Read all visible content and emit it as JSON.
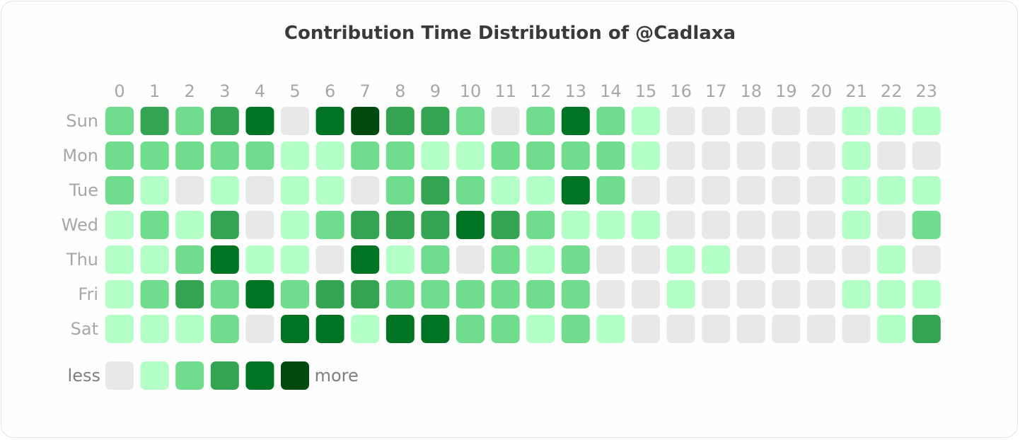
{
  "chart_data": {
    "type": "heatmap",
    "title": "Contribution Time Distribution of @Cadlaxa",
    "xlabel": "",
    "ylabel": "",
    "x": [
      "0",
      "1",
      "2",
      "3",
      "4",
      "5",
      "6",
      "7",
      "8",
      "9",
      "10",
      "11",
      "12",
      "13",
      "14",
      "15",
      "16",
      "17",
      "18",
      "19",
      "20",
      "21",
      "22",
      "23"
    ],
    "y": [
      "Sun",
      "Mon",
      "Tue",
      "Wed",
      "Thu",
      "Fri",
      "Sat"
    ],
    "levels": [
      [
        2,
        3,
        2,
        3,
        4,
        0,
        4,
        5,
        3,
        3,
        2,
        0,
        2,
        4,
        2,
        1,
        0,
        0,
        0,
        0,
        0,
        1,
        1,
        1
      ],
      [
        2,
        2,
        2,
        2,
        2,
        1,
        1,
        2,
        2,
        1,
        1,
        2,
        2,
        2,
        2,
        1,
        0,
        0,
        0,
        0,
        0,
        1,
        0,
        0
      ],
      [
        2,
        1,
        0,
        1,
        0,
        1,
        1,
        0,
        2,
        3,
        2,
        1,
        1,
        4,
        2,
        0,
        0,
        0,
        0,
        0,
        0,
        1,
        1,
        1
      ],
      [
        1,
        2,
        1,
        3,
        0,
        1,
        2,
        3,
        3,
        3,
        4,
        3,
        2,
        1,
        1,
        1,
        0,
        0,
        0,
        0,
        0,
        1,
        0,
        2
      ],
      [
        1,
        1,
        2,
        4,
        1,
        1,
        0,
        4,
        1,
        2,
        0,
        2,
        1,
        2,
        0,
        0,
        1,
        1,
        0,
        0,
        0,
        0,
        1,
        0
      ],
      [
        1,
        2,
        3,
        2,
        4,
        2,
        3,
        3,
        2,
        2,
        2,
        2,
        2,
        2,
        0,
        0,
        1,
        0,
        0,
        0,
        0,
        1,
        1,
        1
      ],
      [
        1,
        1,
        1,
        2,
        0,
        4,
        4,
        1,
        4,
        4,
        2,
        2,
        1,
        2,
        1,
        0,
        0,
        0,
        0,
        0,
        0,
        0,
        1,
        3
      ]
    ],
    "level_range": [
      0,
      5
    ],
    "colors": [
      "#e8e8e8",
      "#b3ffc7",
      "#6fdd8d",
      "#35a452",
      "#007423",
      "#004a10"
    ],
    "legend": {
      "low_label": "less",
      "high_label": "more",
      "placement": "bottom-left"
    }
  }
}
